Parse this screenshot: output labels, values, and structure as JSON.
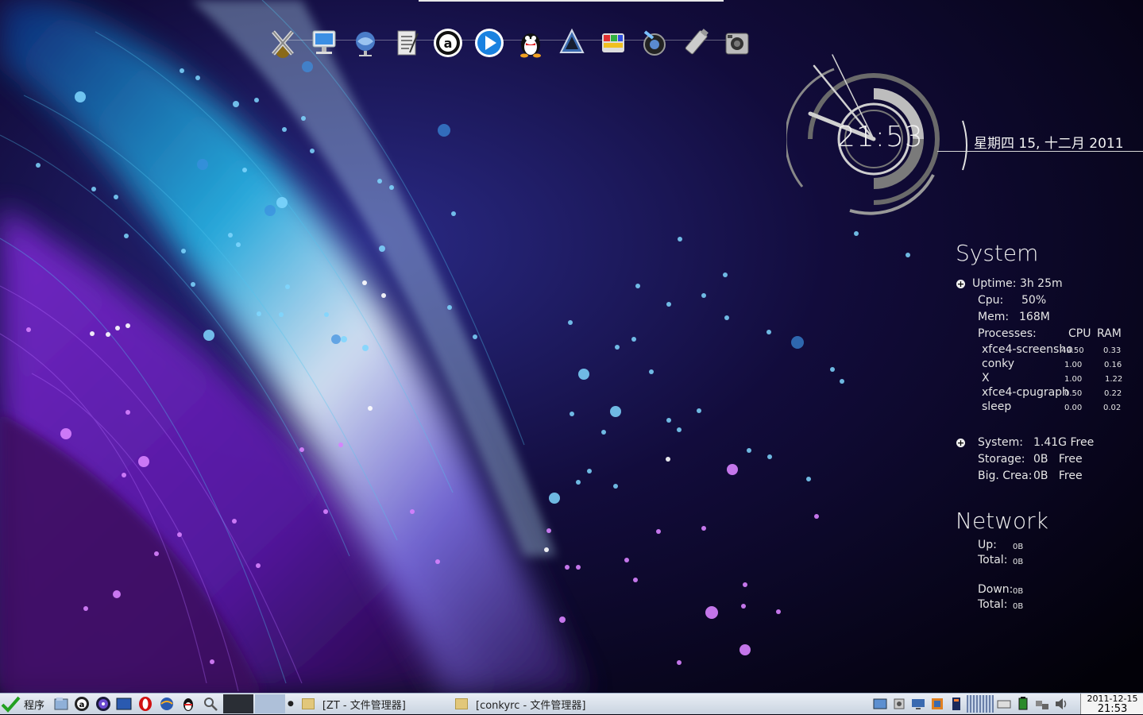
{
  "dock": {
    "icons": [
      "crossover-icon",
      "computer-icon",
      "browser-globe-icon",
      "notes-icon",
      "amule-icon",
      "media-player-icon",
      "qq-penguin-icon",
      "inkscape-icon",
      "palette-icon",
      "camera-lens-icon",
      "usb-drive-icon",
      "camera-icon"
    ]
  },
  "clock": {
    "time": "21:53",
    "date": "星期四 15, 十二月 2011"
  },
  "system": {
    "title": "System",
    "uptime_label": "Uptime:",
    "uptime": "3h 25m",
    "cpu_label": "Cpu:",
    "cpu": "50%",
    "mem_label": "Mem:",
    "mem": "168M",
    "processes_label": "Processes:",
    "cpu_col": "CPU",
    "ram_col": "RAM",
    "processes": [
      {
        "name": "xfce4-screensho",
        "cpu": "49.50",
        "ram": "0.33"
      },
      {
        "name": "conky",
        "cpu": "1.00",
        "ram": "0.16"
      },
      {
        "name": "X",
        "cpu": "1.00",
        "ram": "1.22"
      },
      {
        "name": "xfce4-cpugraph",
        "cpu": "0.50",
        "ram": "0.22"
      },
      {
        "name": "sleep",
        "cpu": "0.00",
        "ram": "0.02"
      }
    ],
    "storage": [
      {
        "label": "System:",
        "value": "1.41G Free"
      },
      {
        "label": "Storage:",
        "value": "0B   Free"
      },
      {
        "label": "Big. Crea:",
        "value": "0B   Free"
      }
    ]
  },
  "network": {
    "title": "Network",
    "up_label": "Up:",
    "up": "0B",
    "up_total_label": "Total:",
    "up_total": "0B",
    "down_label": "Down:",
    "down": "0B",
    "down_total_label": "Total:",
    "down_total": "0B"
  },
  "taskbar": {
    "start_label": "程序",
    "tasks": [
      {
        "label": "[ZT - 文件管理器]"
      },
      {
        "label": "[conkyrc - 文件管理器]"
      }
    ],
    "clock_date": "2011-12-15",
    "clock_time": "21:53"
  }
}
